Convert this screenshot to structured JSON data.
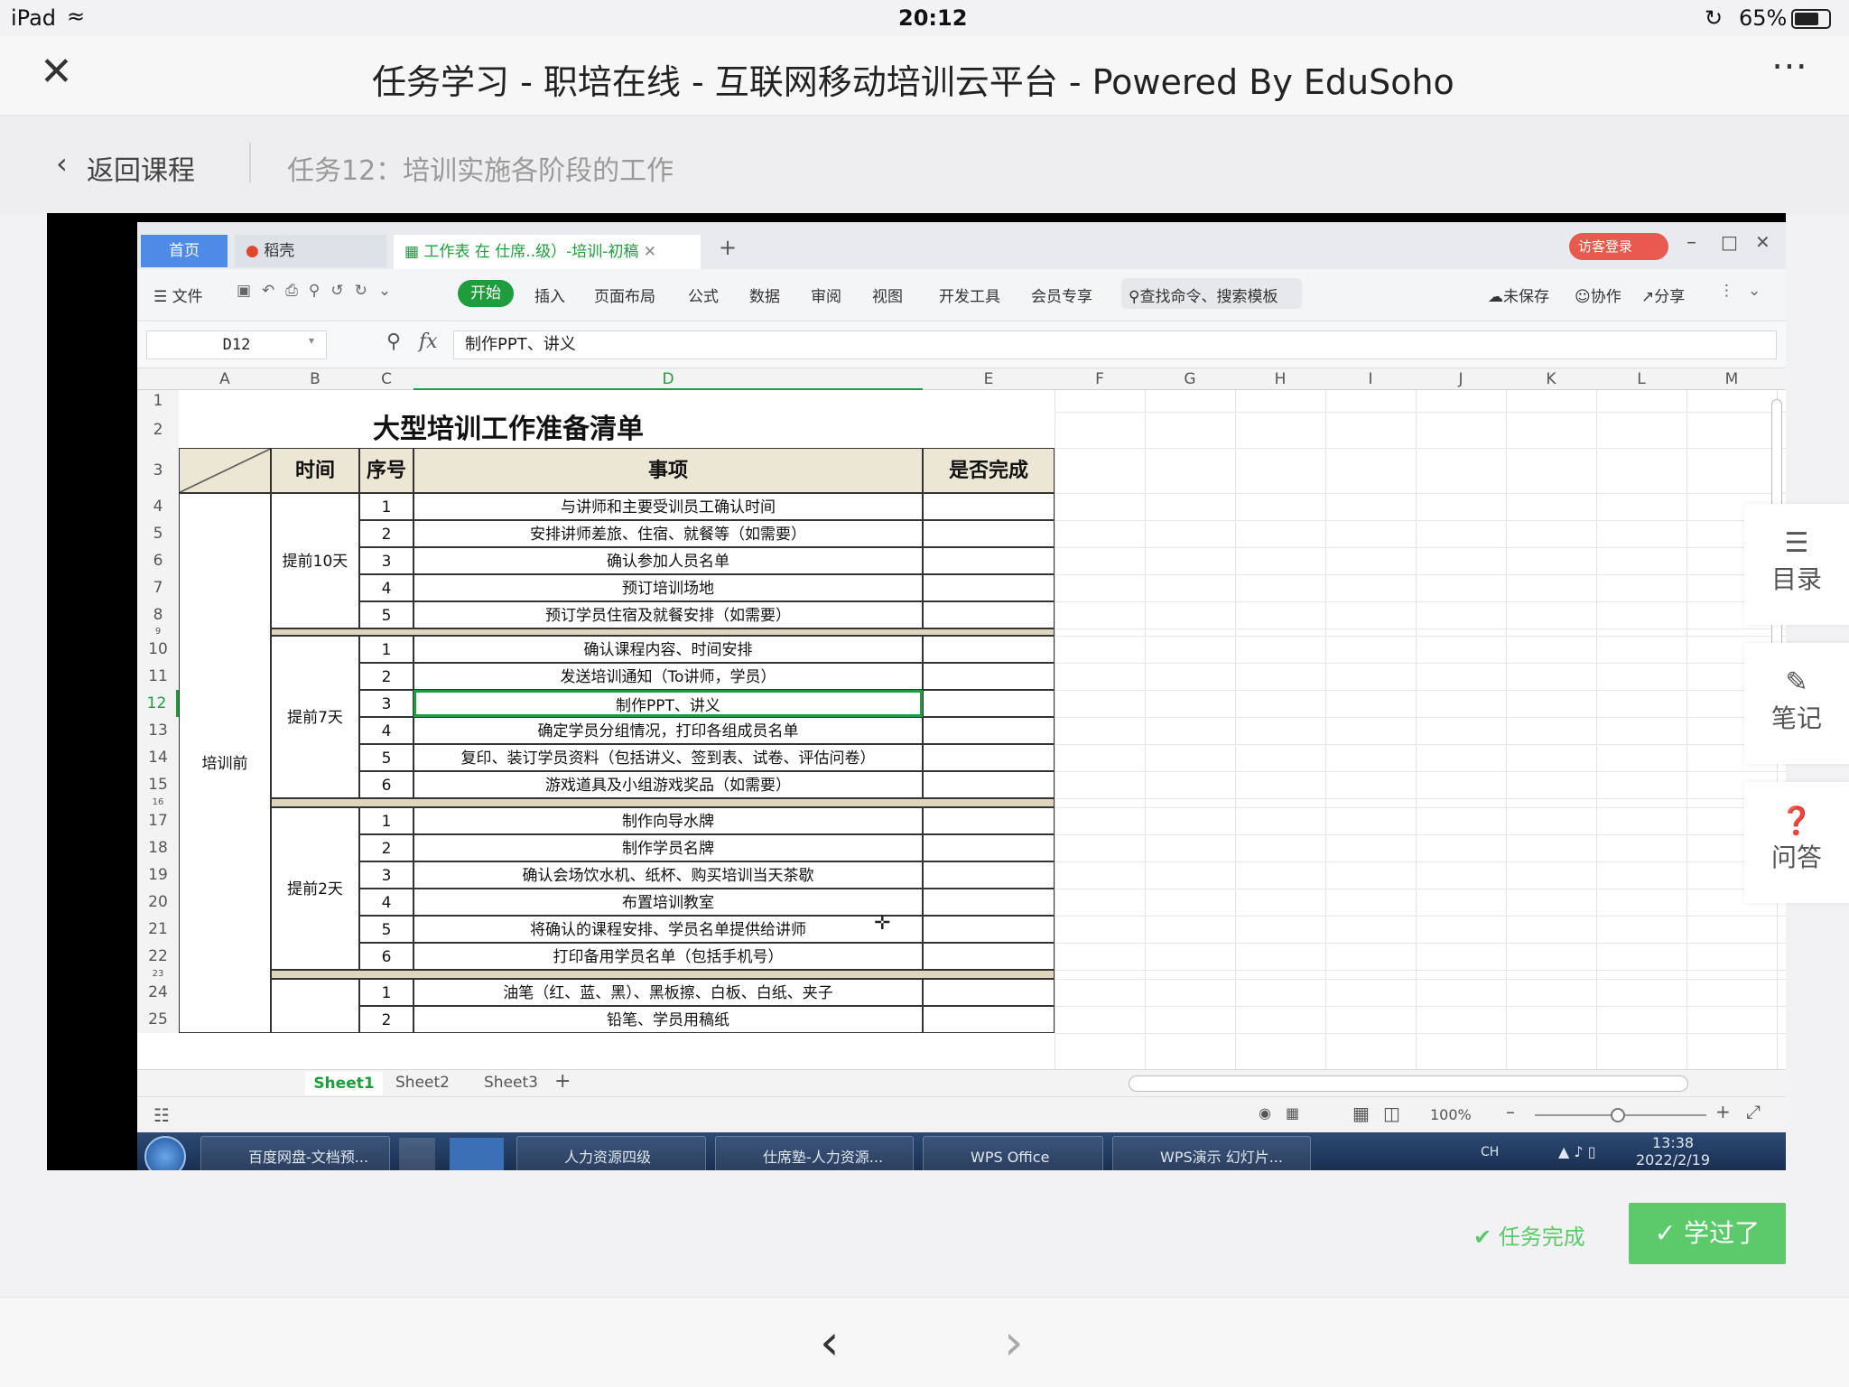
{
  "status": {
    "device": "iPad",
    "time": "20:12",
    "battery": "65%"
  },
  "title": "任务学习 - 职培在线 - 互联网移动培训云平台 - Powered By EduSoho",
  "crumb": {
    "back": "返回课程",
    "task": "任务12：培训实施各阶段的工作"
  },
  "wps": {
    "tab_home": "首页",
    "tab_draft": "稻壳",
    "tab_doc": "工作表 在 仕席..级）-培训-初稿",
    "visitor": "访客登录",
    "menu": [
      "文件",
      "开始",
      "插入",
      "页面布局",
      "公式",
      "数据",
      "审阅",
      "视图",
      "开发工具",
      "会员专享"
    ],
    "search": "查找命令、搜索模板",
    "actions": [
      "未保存",
      "协作",
      "分享"
    ],
    "namebox": "D12",
    "formula": "制作PPT、讲义",
    "columns": [
      "A",
      "B",
      "C",
      "D",
      "E",
      "F",
      "G",
      "H",
      "I",
      "J",
      "K",
      "L",
      "M"
    ],
    "sheet_title": "大型培训工作准备清单",
    "header": {
      "time": "时间",
      "seq": "序号",
      "item": "事项",
      "done": "是否完成"
    },
    "phase": "培训前",
    "groups": [
      {
        "label": "提前10天",
        "rows": [
          {
            "row": "4",
            "seq": "1",
            "item": "与讲师和主要受训员工确认时间"
          },
          {
            "row": "5",
            "seq": "2",
            "item": "安排讲师差旅、住宿、就餐等（如需要）"
          },
          {
            "row": "6",
            "seq": "3",
            "item": "确认参加人员名单"
          },
          {
            "row": "7",
            "seq": "4",
            "item": "预订培训场地"
          },
          {
            "row": "8",
            "seq": "5",
            "item": "预订学员住宿及就餐安排（如需要）"
          }
        ]
      },
      {
        "label": "提前7天",
        "rows": [
          {
            "row": "10",
            "seq": "1",
            "item": "确认课程内容、时间安排"
          },
          {
            "row": "11",
            "seq": "2",
            "item": "发送培训通知（To讲师，学员）"
          },
          {
            "row": "12",
            "seq": "3",
            "item": "制作PPT、讲义"
          },
          {
            "row": "13",
            "seq": "4",
            "item": "确定学员分组情况，打印各组成员名单"
          },
          {
            "row": "14",
            "seq": "5",
            "item": "复印、装订学员资料（包括讲义、签到表、试卷、评估问卷）"
          },
          {
            "row": "15",
            "seq": "6",
            "item": "游戏道具及小组游戏奖品（如需要）"
          }
        ]
      },
      {
        "label": "提前2天",
        "rows": [
          {
            "row": "17",
            "seq": "1",
            "item": "制作向导水牌"
          },
          {
            "row": "18",
            "seq": "2",
            "item": "制作学员名牌"
          },
          {
            "row": "19",
            "seq": "3",
            "item": "确认会场饮水机、纸杯、购买培训当天茶歇"
          },
          {
            "row": "20",
            "seq": "4",
            "item": "布置培训教室"
          },
          {
            "row": "21",
            "seq": "5",
            "item": "将确认的课程安排、学员名单提供给讲师"
          },
          {
            "row": "22",
            "seq": "6",
            "item": "打印备用学员名单（包括手机号）"
          }
        ]
      },
      {
        "label": "",
        "rows": [
          {
            "row": "24",
            "seq": "1",
            "item": "油笔（红、蓝、黑）、黑板擦、白板、白纸、夹子"
          },
          {
            "row": "25",
            "seq": "2",
            "item": "铅笔、学员用稿纸"
          }
        ]
      }
    ],
    "sheets": [
      "Sheet1",
      "Sheet2",
      "Sheet3"
    ],
    "zoom": "100%",
    "taskbar": [
      "百度网盘-文档预...",
      "人力资源四级",
      "仕席塾-人力资源...",
      "WPS Office",
      "WPS演示 幻灯片..."
    ],
    "clock_time": "13:38",
    "clock_date": "2022/2/19",
    "ime": "CH"
  },
  "side": [
    "目录",
    "笔记",
    "问答"
  ],
  "footer": {
    "complete": "任务完成",
    "learned": "学过了"
  },
  "colors": {
    "green": "#5cc96a",
    "wps_tab_blue": "#4d8be6",
    "wps_green": "#1f9d3d"
  }
}
